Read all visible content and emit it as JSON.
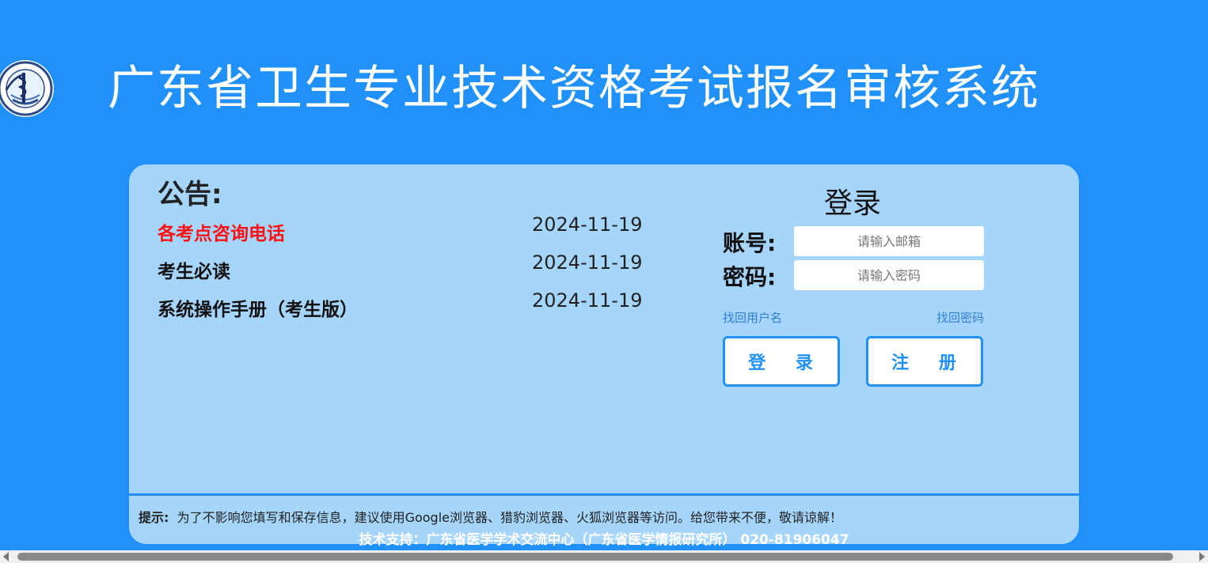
{
  "header": {
    "logo_icon": "health-association-emblem",
    "title": "广东省卫生专业技术资格考试报名审核系统"
  },
  "notice": {
    "title": "公告:",
    "items": [
      {
        "label": "各考点咨询电话",
        "date": "2024-11-19",
        "color": "#ff1010"
      },
      {
        "label": "考生必读",
        "date": "2024-11-19",
        "color": "#111111"
      },
      {
        "label": "系统操作手册（考生版）",
        "date": "2024-11-19",
        "color": "#111111"
      }
    ]
  },
  "login": {
    "title": "登录",
    "account_label": "账号:",
    "account_placeholder": "请输入邮箱",
    "password_label": "密码:",
    "password_placeholder": "请输入密码",
    "recover_username": "找回用户名",
    "recover_password": "找回密码",
    "login_button": "登 录",
    "register_button": "注 册"
  },
  "tip": {
    "prefix": "提示:",
    "text": "为了不影响您填写和保存信息，建议使用Google浏览器、猎豹浏览器、火狐浏览器等访问。给您带来不便，敬请谅解！"
  },
  "footer": {
    "support": "技术支持：广东省医学学术交流中心（广东省医学情报研究所） 020-81906047"
  },
  "colors": {
    "background": "#2090fb",
    "panel": "#a6d5fc",
    "accent": "#2090fb",
    "notice_highlight": "#ff1010"
  }
}
